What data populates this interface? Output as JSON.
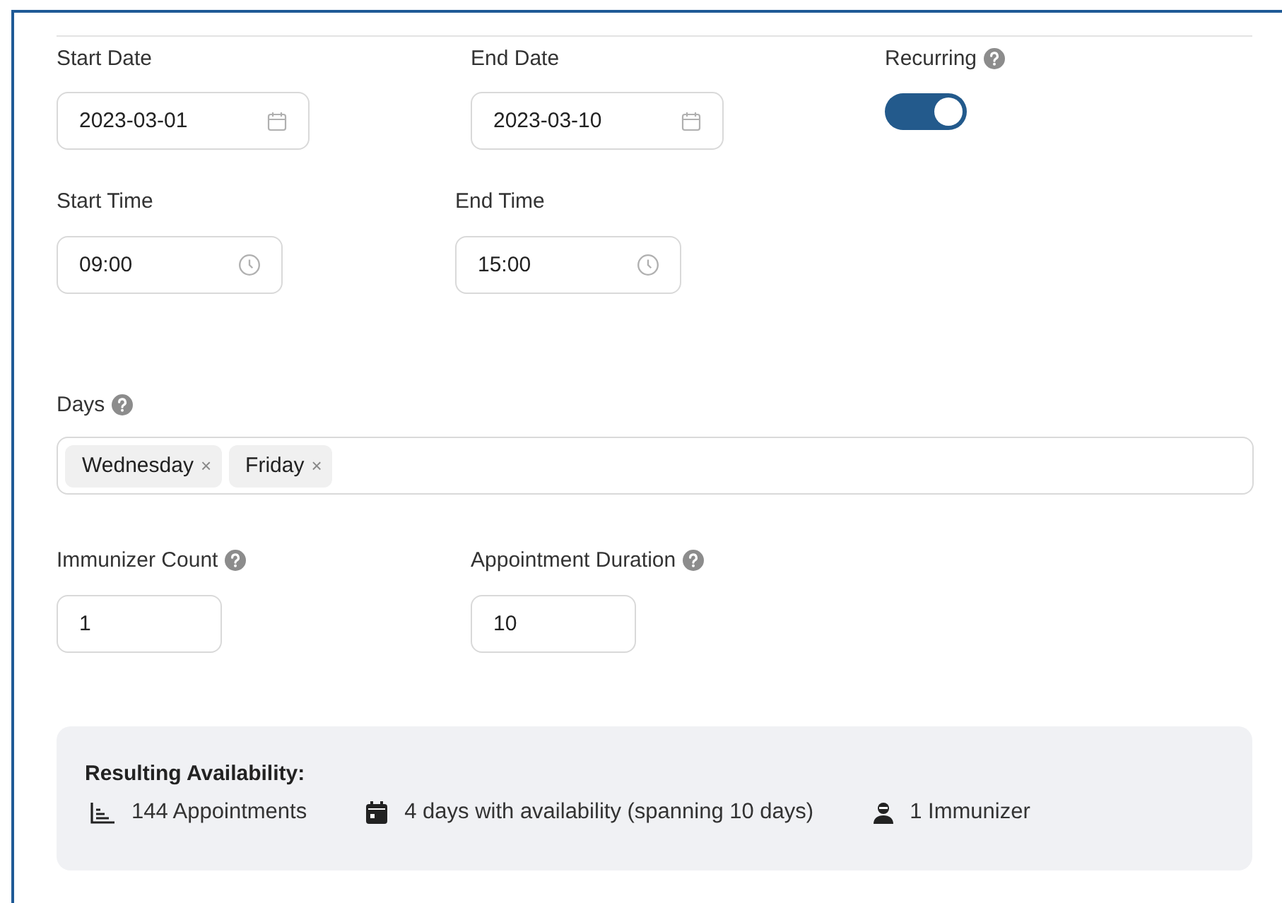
{
  "dates": [
    {
      "label": "Start Date",
      "value": "2023-03-01"
    },
    {
      "label": "End Date",
      "value": "2023-03-10"
    }
  ],
  "recurring": {
    "label": "Recurring",
    "on": true
  },
  "times": [
    {
      "label": "Start Time",
      "value": "09:00"
    },
    {
      "label": "End Time",
      "value": "15:00"
    }
  ],
  "days": {
    "label": "Days",
    "tags": [
      {
        "label": "Wednesday",
        "remove": "×"
      },
      {
        "label": "Friday",
        "remove": "×"
      }
    ]
  },
  "numbers": [
    {
      "label": "Immunizer Count",
      "value": "1"
    },
    {
      "label": "Appointment Duration",
      "value": "10"
    }
  ],
  "summary": {
    "title": "Resulting Availability:",
    "items": [
      {
        "kind": "appointments",
        "text": "144 Appointments"
      },
      {
        "kind": "days",
        "text": "4 days with availability (spanning 10 days)"
      },
      {
        "kind": "immunizers",
        "text": "1 Immunizer"
      }
    ]
  }
}
